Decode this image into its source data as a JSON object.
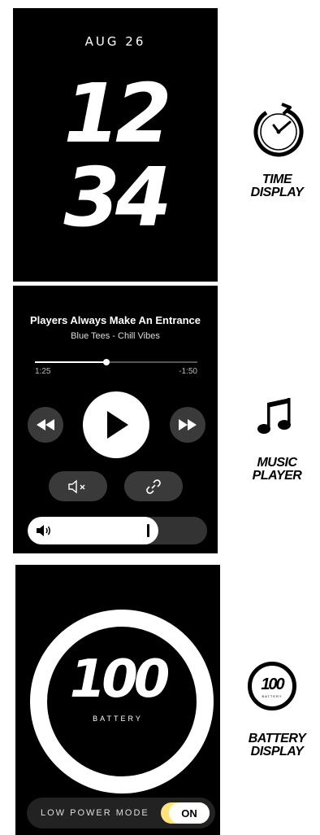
{
  "time_display": {
    "date": "AUG 26",
    "hours": "12",
    "minutes": "34",
    "label_line1": "TIME",
    "label_line2": "DISPLAY",
    "icon": "stopwatch-icon"
  },
  "music_player": {
    "song_title": "Players Always Make An Entrance",
    "artist_album": "Blue Tees - Chill Vibes",
    "elapsed": "1:25",
    "remaining": "-1:50",
    "progress": 0.44,
    "volume": 0.73,
    "label_line1": "MUSIC",
    "label_line2": "PLAYER",
    "icons": [
      "rewind-icon",
      "play-icon",
      "fast-forward-icon",
      "mute-icon",
      "link-icon",
      "volume-icon",
      "music-note-icon"
    ]
  },
  "battery_display": {
    "level": "100",
    "level_label": "BATTERY",
    "low_power_label": "LOW POWER MODE",
    "toggle_state": "ON",
    "label_line1": "BATTERY",
    "label_line2": "DISPLAY",
    "mini_level": "100",
    "mini_label": "BATTERY",
    "toggle_color": "#ffe27a"
  }
}
